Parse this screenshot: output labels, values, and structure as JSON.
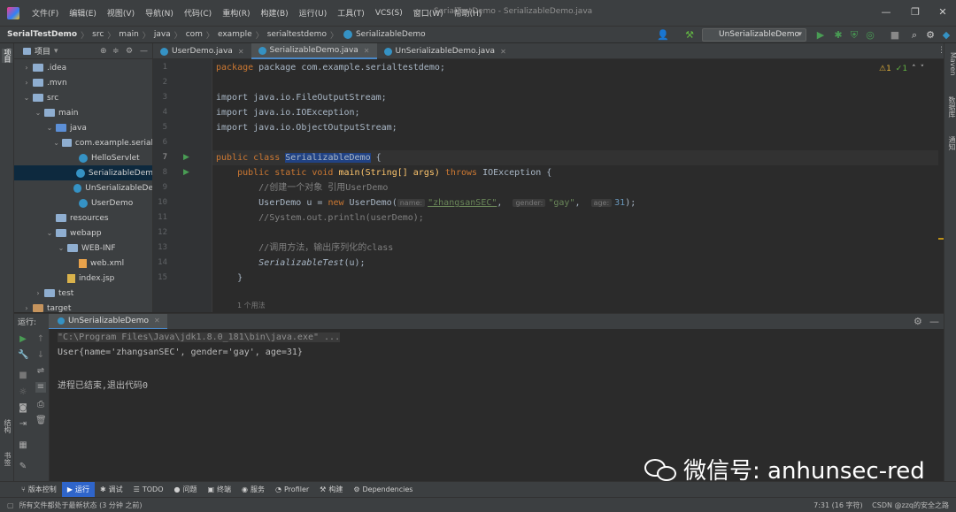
{
  "menu": {
    "items": [
      "文件(F)",
      "编辑(E)",
      "视图(V)",
      "导航(N)",
      "代码(C)",
      "重构(R)",
      "构建(B)",
      "运行(U)",
      "工具(T)",
      "VCS(S)",
      "窗口(W)",
      "帮助(H)"
    ],
    "window_title": "SerialTestDemo - SerializableDemo.java"
  },
  "breadcrumb": [
    "SerialTestDemo",
    "src",
    "main",
    "java",
    "com",
    "example",
    "serialtestdemo",
    "SerializableDemo"
  ],
  "run_config": "UnSerializableDemo",
  "left_strip": {
    "project_tab": "项目",
    "bookmarks_tab": "书签",
    "structure_tab": "结构"
  },
  "right_strip": {
    "maven_tab": "Maven",
    "database_tab": "数据库",
    "notifications_tab": "通知"
  },
  "project": {
    "header": "项目",
    "tree": [
      {
        "label": ".idea",
        "indent": 1,
        "arrow": "›",
        "icon": "folder"
      },
      {
        "label": ".mvn",
        "indent": 1,
        "arrow": "›",
        "icon": "folder"
      },
      {
        "label": "src",
        "indent": 1,
        "arrow": "⌄",
        "icon": "folder"
      },
      {
        "label": "main",
        "indent": 2,
        "arrow": "⌄",
        "icon": "folder"
      },
      {
        "label": "java",
        "indent": 3,
        "arrow": "⌄",
        "icon": "src"
      },
      {
        "label": "com.example.serial",
        "indent": 4,
        "arrow": "⌄",
        "icon": "folder"
      },
      {
        "label": "HelloServlet",
        "indent": 5,
        "arrow": "",
        "icon": "class"
      },
      {
        "label": "SerializableDem",
        "indent": 5,
        "arrow": "",
        "icon": "class",
        "selected": true
      },
      {
        "label": "UnSerializableDe",
        "indent": 5,
        "arrow": "",
        "icon": "class"
      },
      {
        "label": "UserDemo",
        "indent": 5,
        "arrow": "",
        "icon": "class"
      },
      {
        "label": "resources",
        "indent": 3,
        "arrow": "",
        "icon": "folder"
      },
      {
        "label": "webapp",
        "indent": 3,
        "arrow": "⌄",
        "icon": "folder"
      },
      {
        "label": "WEB-INF",
        "indent": 4,
        "arrow": "⌄",
        "icon": "folder"
      },
      {
        "label": "web.xml",
        "indent": 5,
        "arrow": "",
        "icon": "xml"
      },
      {
        "label": "index.jsp",
        "indent": 4,
        "arrow": "",
        "icon": "jsp"
      },
      {
        "label": "test",
        "indent": 2,
        "arrow": "›",
        "icon": "folder"
      },
      {
        "label": "target",
        "indent": 1,
        "arrow": "›",
        "icon": "orange"
      }
    ]
  },
  "editor": {
    "tabs": [
      {
        "label": "UserDemo.java",
        "active": false
      },
      {
        "label": "SerializableDemo.java",
        "active": true
      },
      {
        "label": "UnSerializableDemo.java",
        "active": false
      }
    ],
    "line_numbers": [
      "1",
      "2",
      "3",
      "4",
      "5",
      "6",
      "7",
      "8",
      "9",
      "10",
      "11",
      "12",
      "13",
      "14",
      "15"
    ],
    "current_line": "7",
    "usages_hint": "1 个用法",
    "inspections": {
      "warnings": "⚠1",
      "ok": "✓1"
    },
    "hints": {
      "name": "name:",
      "gender": "gender:",
      "age": "age:"
    },
    "code": {
      "l1": "package com.example.serialtestdemo;",
      "l3": "import java.io.FileOutputStream;",
      "l4": "import java.io.IOException;",
      "l5": "import java.io.ObjectOutputStream;",
      "l7_kw": "public class ",
      "l7_name": "SerializableDemo",
      "l7_rest": " {",
      "l8_kw": "    public static void ",
      "l8_mid": "main(String[] args) ",
      "l8_kw2": "throws ",
      "l8_rest": "IOException {",
      "l9": "        //创建一个对象 引用UserDemo",
      "l10_a": "        UserDemo u = ",
      "l10_new": "new ",
      "l10_b": "UserDemo(",
      "l10_s1": "\"zhangsanSEC\"",
      "l10_c": ",  ",
      "l10_s2": "\"gay\"",
      "l10_d": ",  ",
      "l10_n": "31",
      "l10_e": ");",
      "l11": "        //System.out.println(userDemo);",
      "l13": "        //调用方法，输出序列化的class",
      "l14_a": "        ",
      "l14_b": "SerializableTest",
      "l14_c": "(u);",
      "l15": "    }"
    }
  },
  "run_panel": {
    "label": "运行:",
    "tab": "UnSerializableDemo",
    "console": [
      "\"C:\\Program Files\\Java\\jdk1.8.0_181\\bin\\java.exe\" ...",
      "User{name='zhangsanSEC', gender='gay', age=31}",
      "",
      "进程已结束,退出代码0"
    ]
  },
  "bottom_tabs": [
    {
      "label": "版本控制",
      "icon": "⑂"
    },
    {
      "label": "运行",
      "icon": "▶",
      "active": true
    },
    {
      "label": "调试",
      "icon": "✱"
    },
    {
      "label": "TODO",
      "icon": "☰"
    },
    {
      "label": "问题",
      "icon": "●"
    },
    {
      "label": "终端",
      "icon": "▣"
    },
    {
      "label": "服务",
      "icon": "◉"
    },
    {
      "label": "Profiler",
      "icon": "◔"
    },
    {
      "label": "构建",
      "icon": "⚒"
    },
    {
      "label": "Dependencies",
      "icon": "⚙"
    }
  ],
  "status": {
    "left": "所有文件都处于最新状态 (3 分钟 之前)",
    "right": "7:31 (16 字符)",
    "csdn": "CSDN @zzq的安全之路"
  },
  "watermark": "微信号: anhunsec-red",
  "colors": {
    "accent": "#2f65ca",
    "keyword": "#cc7832",
    "string": "#6a8759",
    "comment": "#808080",
    "number": "#6897bb"
  }
}
